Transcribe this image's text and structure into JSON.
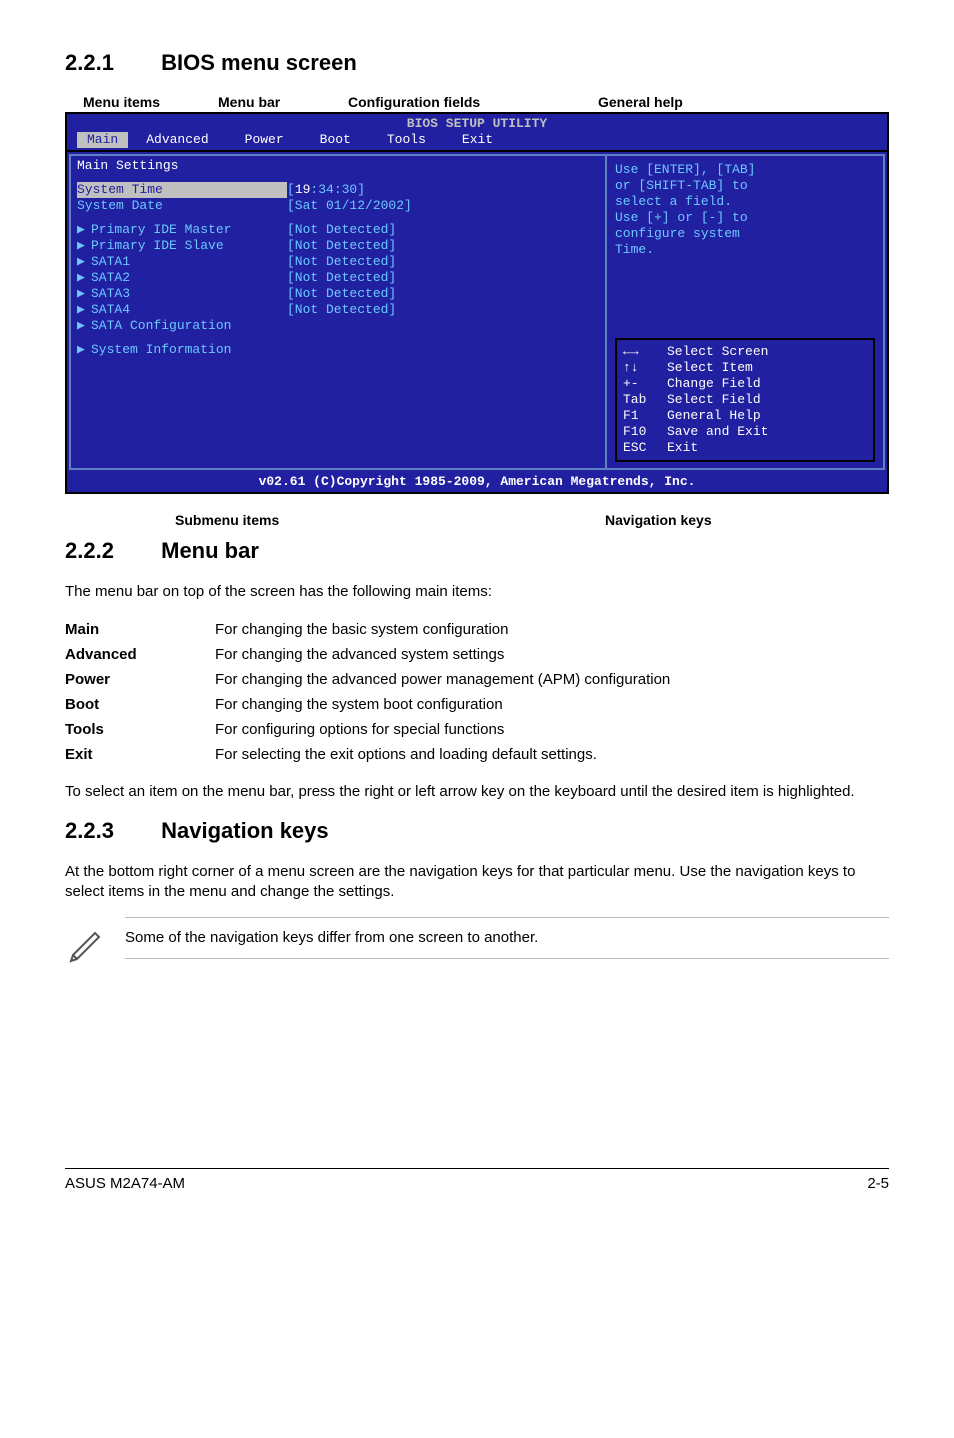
{
  "section1": {
    "num": "2.2.1",
    "title": "BIOS menu screen"
  },
  "top_labels": {
    "menu_items": "Menu items",
    "menu_bar": "Menu bar",
    "config_fields": "Configuration fields",
    "general_help": "General help"
  },
  "bios": {
    "title": "BIOS SETUP UTILITY",
    "tabs": [
      "Main",
      "Advanced",
      "Power",
      "Boot",
      "Tools",
      "Exit"
    ],
    "selected_tab": "Main",
    "main_heading": "Main Settings",
    "rows": [
      {
        "label": "System Time",
        "highlight": true,
        "value_prefix": "[",
        "value_hl": "19",
        "value_rest": ":34:30]"
      },
      {
        "label": "System Date",
        "highlight": false,
        "value": "[Sat 01/12/2002]"
      }
    ],
    "device_rows": [
      {
        "label": "Primary IDE Master",
        "value": "[Not Detected]"
      },
      {
        "label": "Primary IDE Slave",
        "value": "[Not Detected]"
      },
      {
        "label": "SATA1",
        "value": "[Not Detected]"
      },
      {
        "label": "SATA2",
        "value": "[Not Detected]"
      },
      {
        "label": "SATA3",
        "value": "[Not Detected]"
      },
      {
        "label": "SATA4",
        "value": "[Not Detected]"
      },
      {
        "label": "SATA Configuration",
        "value": ""
      }
    ],
    "sys_info": "System Information",
    "help_lines": [
      "Use [ENTER], [TAB]",
      "or [SHIFT-TAB] to",
      "select a field.",
      "",
      "Use [+] or [-] to",
      "configure system",
      "Time."
    ],
    "nav": [
      {
        "k": "←→",
        "d": "Select Screen"
      },
      {
        "k": "↑↓",
        "d": "Select Item"
      },
      {
        "k": "+-",
        "d": "Change Field"
      },
      {
        "k": "Tab",
        "d": "Select Field"
      },
      {
        "k": "F1",
        "d": "General Help"
      },
      {
        "k": "F10",
        "d": "Save and Exit"
      },
      {
        "k": "ESC",
        "d": "Exit"
      }
    ],
    "footer": "v02.61 (C)Copyright 1985-2009, American Megatrends, Inc."
  },
  "bottom_labels": {
    "submenu": "Submenu items",
    "navkeys": "Navigation keys"
  },
  "section2": {
    "num": "2.2.2",
    "title": "Menu bar"
  },
  "section2_intro": "The menu bar on top of the screen has the following main items:",
  "menu_desc": [
    {
      "k": "Main",
      "d": "For changing the basic system configuration"
    },
    {
      "k": "Advanced",
      "d": "For changing the advanced system settings"
    },
    {
      "k": "Power",
      "d": "For changing the advanced power management (APM) configuration"
    },
    {
      "k": "Boot",
      "d": "For changing the system boot configuration"
    },
    {
      "k": "Tools",
      "d": "For configuring options for special functions"
    },
    {
      "k": "Exit",
      "d": "For selecting the exit options and loading default settings."
    }
  ],
  "section2_outro": "To select an item on the menu bar, press the right or left arrow key on the keyboard until the desired item is highlighted.",
  "section3": {
    "num": "2.2.3",
    "title": "Navigation keys"
  },
  "section3_body": "At the bottom right corner of a menu screen are the navigation keys for that particular menu. Use the navigation keys to select items in the menu and change the settings.",
  "note": "Some of the navigation keys differ from one screen to another.",
  "footer": {
    "left": "ASUS M2A74-AM",
    "right": "2-5"
  }
}
